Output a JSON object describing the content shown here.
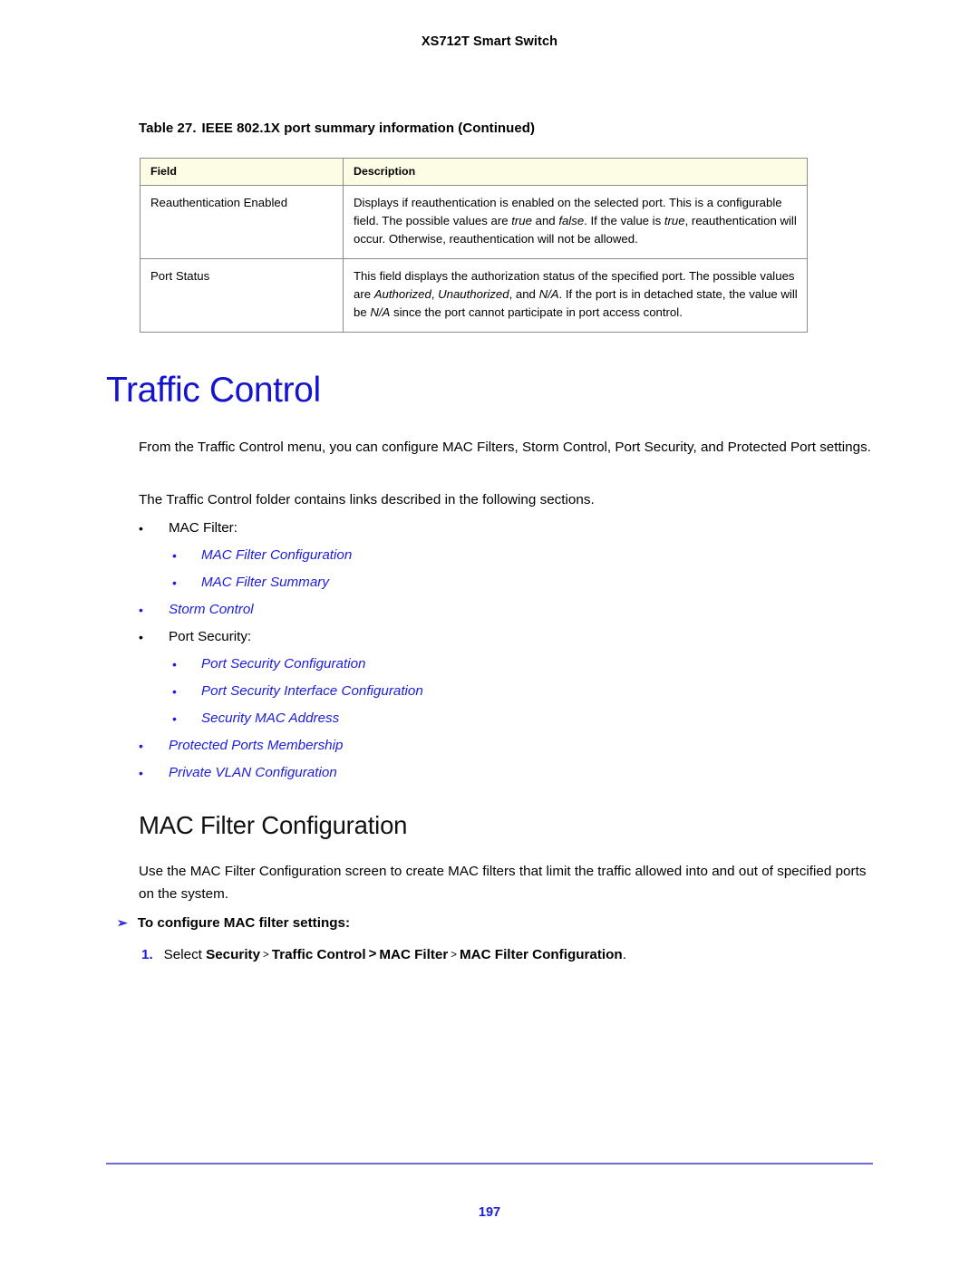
{
  "header": {
    "running_title": "XS712T Smart Switch"
  },
  "table": {
    "caption_number": "Table 27.",
    "caption_text": "IEEE 802.1X port summary information (Continued)",
    "columns": [
      "Field",
      "Description"
    ],
    "header_bg": "#FDFCE4",
    "border_color": "#8C8C8C",
    "rows": [
      {
        "field": "Reauthentication Enabled",
        "description_runs": [
          {
            "text": "Displays if reauthentication is enabled on the selected port. This is a configurable field. The possible values are ",
            "style": "normal"
          },
          {
            "text": "true",
            "style": "italic"
          },
          {
            "text": " and ",
            "style": "normal"
          },
          {
            "text": "false",
            "style": "italic"
          },
          {
            "text": ". If the value is ",
            "style": "normal"
          },
          {
            "text": "true",
            "style": "italic"
          },
          {
            "text": ", reauthentication will occur. Otherwise, reauthentication will not be allowed.",
            "style": "normal"
          }
        ]
      },
      {
        "field": "Port Status",
        "description_runs": [
          {
            "text": "This field displays the authorization status of the specified port. The possible values are ",
            "style": "normal"
          },
          {
            "text": "Authorized",
            "style": "italic"
          },
          {
            "text": ", ",
            "style": "normal"
          },
          {
            "text": "Unauthorized",
            "style": "italic"
          },
          {
            "text": ", and ",
            "style": "normal"
          },
          {
            "text": "N/A",
            "style": "italic"
          },
          {
            "text": ". If the port is in detached state, the value will be ",
            "style": "normal"
          },
          {
            "text": "N/A",
            "style": "italic"
          },
          {
            "text": " since the port cannot participate in port access control.",
            "style": "normal"
          }
        ]
      }
    ]
  },
  "section_traffic_control": {
    "heading": "Traffic Control",
    "heading_color": "#1414CC",
    "paragraph_intro": "From the Traffic Control menu, you can configure MAC Filters, Storm Control, Port Security, and Protected Port settings.",
    "paragraph_folder": "The Traffic Control folder contains links described in the following sections.",
    "link_color": "#1C1CE0",
    "list": [
      {
        "level": 1,
        "label": "MAC Filter:",
        "kind": "plain"
      },
      {
        "level": 2,
        "label": "MAC Filter Configuration",
        "kind": "link"
      },
      {
        "level": 2,
        "label": "MAC Filter Summary",
        "kind": "link"
      },
      {
        "level": 1,
        "label": "Storm Control",
        "kind": "link"
      },
      {
        "level": 1,
        "label": "Port Security:",
        "kind": "plain"
      },
      {
        "level": 2,
        "label": "Port Security Configuration",
        "kind": "link"
      },
      {
        "level": 2,
        "label": "Port Security Interface Configuration",
        "kind": "link"
      },
      {
        "level": 2,
        "label": "Security MAC Address",
        "kind": "link"
      },
      {
        "level": 1,
        "label": "Protected Ports Membership",
        "kind": "link"
      },
      {
        "level": 1,
        "label": "Private VLAN Configuration",
        "kind": "link"
      }
    ]
  },
  "section_mac_filter_configuration": {
    "heading": "MAC Filter Configuration",
    "paragraph": "Use the MAC Filter Configuration screen to create MAC filters that limit the traffic allowed into and out of specified ports on the system.",
    "procedure_marker": "➢",
    "procedure_heading": "To configure MAC filter settings:",
    "step_number": "1.",
    "step_runs": [
      {
        "text": "Select ",
        "style": "normal"
      },
      {
        "text": "Security",
        "style": "bold"
      },
      {
        "text": ">",
        "style": "sep-small"
      },
      {
        "text": "Traffic Control",
        "style": "bold"
      },
      {
        "text": ">",
        "style": "sep-big"
      },
      {
        "text": "MAC Filter",
        "style": "bold"
      },
      {
        "text": ">",
        "style": "sep-small"
      },
      {
        "text": "MAC Filter Configuration",
        "style": "bold"
      },
      {
        "text": ".",
        "style": "normal"
      }
    ]
  },
  "footer": {
    "page_number": "197",
    "rule_color": "#6B6BDC",
    "page_number_color": "#1C1CE0"
  }
}
